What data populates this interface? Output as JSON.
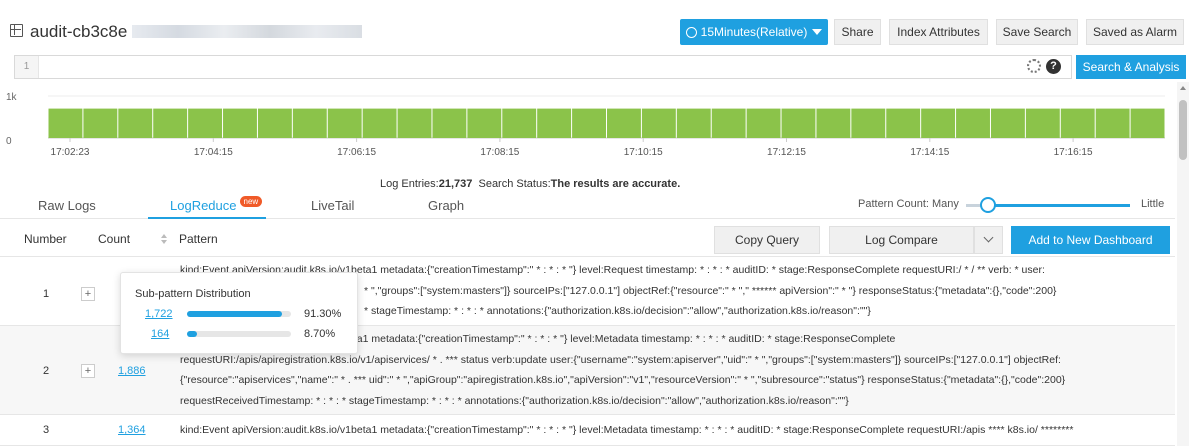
{
  "header": {
    "title": "audit-cb3c8e",
    "time_range": "15Minutes(Relative)",
    "buttons": [
      "Share",
      "Index Attributes",
      "Save Search",
      "Saved as Alarm"
    ]
  },
  "query": {
    "line_number": "1",
    "text": "",
    "search_button": "Search & Analysis"
  },
  "chart_data": {
    "type": "bar",
    "ylim": [
      0,
      1000
    ],
    "y_ticks": [
      "1k",
      "0"
    ],
    "x_ticks": [
      "17:02:23",
      "17:04:15",
      "17:06:15",
      "17:08:15",
      "17:10:15",
      "17:12:15",
      "17:14:15",
      "17:16:15"
    ],
    "bar_count": 32,
    "values": [
      700,
      700,
      700,
      700,
      700,
      700,
      700,
      700,
      700,
      700,
      700,
      700,
      700,
      700,
      700,
      700,
      700,
      700,
      700,
      700,
      700,
      700,
      700,
      700,
      700,
      700,
      700,
      700,
      700,
      700,
      700,
      700
    ],
    "color": "#8bc34a"
  },
  "status": {
    "entries_label": "Log Entries:",
    "entries_value": "21,737",
    "status_label": "Search Status:",
    "status_value": "The results are accurate."
  },
  "tabs": [
    {
      "label": "Raw Logs"
    },
    {
      "label": "LogReduce",
      "badge": "new"
    },
    {
      "label": "LiveTail"
    },
    {
      "label": "Graph"
    }
  ],
  "pattern_count": {
    "label": "Pattern Count: Many",
    "right_label": "Little",
    "level": 0.1
  },
  "table": {
    "columns": [
      "Number",
      "Count",
      "Pattern"
    ],
    "buttons": {
      "copy_query": "Copy Query",
      "log_compare": "Log Compare",
      "add_dashboard": "Add to New Dashboard"
    },
    "rows": [
      {
        "number": "1",
        "count": "",
        "lines": [
          "kind:Event apiVersion:audit.k8s.io/v1beta1 metadata:{\"creationTimestamp\":\" * : * : * \"} level:Request timestamp: * : * : * auditID: * stage:ResponseComplete requestURI:/ * / ** verb: * user:",
          " * \",\"groups\":[\"system:masters\"]} sourceIPs:[\"127.0.0.1\"] objectRef:{\"resource\":\" * \",\" ****** apiVersion\":\" * \"} responseStatus:{\"metadata\":{},\"code\":200}",
          " * stageTimestamp: * : * : * annotations:{\"authorization.k8s.io/decision\":\"allow\",\"authorization.k8s.io/reason\":\"\"}"
        ]
      },
      {
        "number": "2",
        "count": "1,886",
        "lines": [
          "eta1 metadata:{\"creationTimestamp\":\" * : * : * \"} level:Metadata timestamp: * : * : * auditID: * stage:ResponseComplete",
          "requestURI:/apis/apiregistration.k8s.io/v1/apiservices/ * . *** status verb:update user:{\"username\":\"system:apiserver\",\"uid\":\" * \",\"groups\":[\"system:masters\"]} sourceIPs:[\"127.0.0.1\"] objectRef:",
          "{\"resource\":\"apiservices\",\"name\":\" * . *** uid\":\" * \",\"apiGroup\":\"apiregistration.k8s.io\",\"apiVersion\":\"v1\",\"resourceVersion\":\" * \",\"subresource\":\"status\"} responseStatus:{\"metadata\":{},\"code\":200}",
          "requestReceivedTimestamp: * : * : * stageTimestamp: * : * : * annotations:{\"authorization.k8s.io/decision\":\"allow\",\"authorization.k8s.io/reason\":\"\"}"
        ]
      },
      {
        "number": "3",
        "count": "1,364",
        "lines": [
          "kind:Event apiVersion:audit.k8s.io/v1beta1 metadata:{\"creationTimestamp\":\" * : * : * \"} level:Metadata timestamp: * : * : * auditID: * stage:ResponseComplete requestURI:/apis **** k8s.io/ ********"
        ]
      }
    ]
  },
  "popup": {
    "title": "Sub-pattern Distribution",
    "items": [
      {
        "count": "1,722",
        "percent": "91.30%",
        "fraction": 0.913
      },
      {
        "count": "164",
        "percent": "8.70%",
        "fraction": 0.087
      }
    ]
  }
}
